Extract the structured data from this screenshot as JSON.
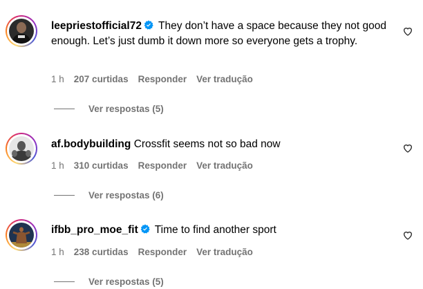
{
  "comments": [
    {
      "username": "leepriestofficial72",
      "verified": true,
      "text": "They don’t have a space because they not good enough. Let’s just dumb it down more so everyone gets a trophy.",
      "time": "1 h",
      "likes": "207 curtidas",
      "reply_label": "Responder",
      "translate_label": "Ver tradução",
      "view_replies": "Ver respostas (5)",
      "avatar_icon": "avatar-photo-icon"
    },
    {
      "username": "af.bodybuilding",
      "verified": false,
      "text": "Crossfit seems not so bad now",
      "time": "1 h",
      "likes": "310 curtidas",
      "reply_label": "Responder",
      "translate_label": "Ver tradução",
      "view_replies": "Ver respostas (6)",
      "avatar_icon": "avatar-photo-icon"
    },
    {
      "username": "ifbb_pro_moe_fit",
      "verified": true,
      "text": "Time to find another sport",
      "time": "1 h",
      "likes": "238 curtidas",
      "reply_label": "Responder",
      "translate_label": "Ver tradução",
      "view_replies": "Ver respostas (5)",
      "avatar_icon": "avatar-photo-icon"
    }
  ],
  "colors": {
    "verified_blue": "#0095f6",
    "meta_gray": "#737373"
  }
}
